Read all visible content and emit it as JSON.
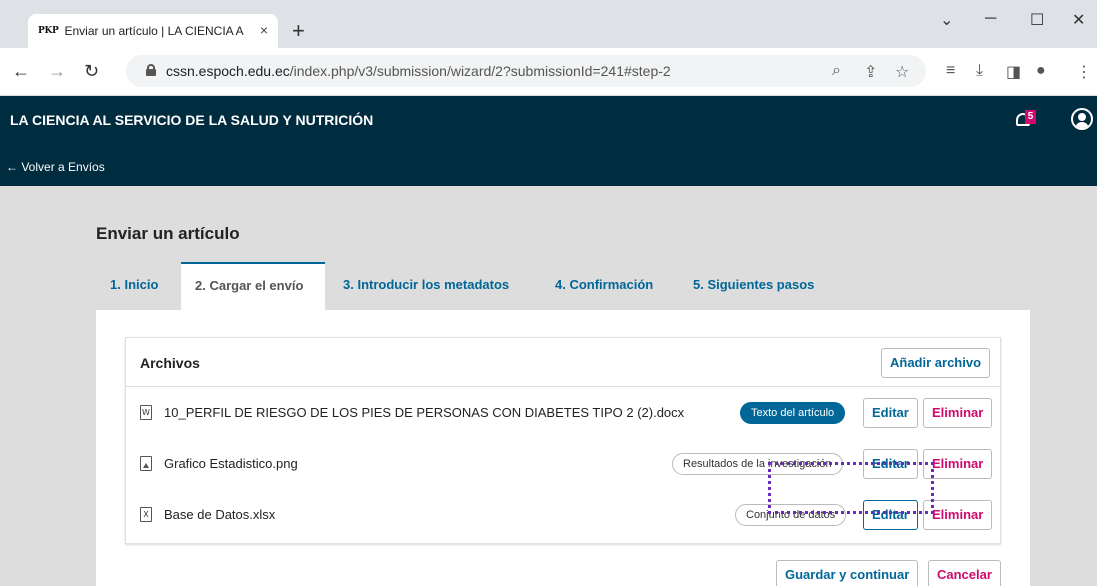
{
  "browser": {
    "tab_title": "Enviar un artículo | LA CIENCIA A",
    "tab_favicon": "PKP",
    "tab_close": "×",
    "new_tab": "+",
    "url_domain": "cssn.espoch.edu.ec",
    "url_path": "/index.php/v3/submission/wizard/2?submissionId=241#step-2",
    "controls": {
      "minimize": "─",
      "maximize": "☐",
      "close": "✕",
      "dropdown": "⌄"
    }
  },
  "app": {
    "site_name": "LA CIENCIA AL SERVICIO DE LA SALUD Y NUTRICIÓN",
    "notification_count": "5",
    "back_link": "← Volver a Envíos"
  },
  "page": {
    "title": "Enviar un artículo",
    "steps": [
      {
        "label": "1. Inicio"
      },
      {
        "label": "2. Cargar el envío"
      },
      {
        "label": "3. Introducir los metadatos"
      },
      {
        "label": "4. Confirmación"
      },
      {
        "label": "5. Siguientes pasos"
      }
    ],
    "active_step": 1
  },
  "files": {
    "title": "Archivos",
    "add_button": "Añadir archivo",
    "edit_label": "Editar",
    "delete_label": "Eliminar",
    "items": [
      {
        "icon": "W",
        "name": "10_PERFIL DE RIESGO DE LOS PIES DE PERSONAS CON DIABETES TIPO 2 (2).docx",
        "genre": "Texto del artículo"
      },
      {
        "icon": "",
        "name": "Grafico Estadistico.png",
        "genre": "Resultados de la investigación"
      },
      {
        "icon": "X",
        "name": "Base de Datos.xlsx",
        "genre": "Conjunto de datos"
      }
    ]
  },
  "actions": {
    "save": "Guardar y continuar",
    "cancel": "Cancelar"
  },
  "colors": {
    "header_bg": "#002c40",
    "primary": "#006798",
    "danger": "#d00a6c",
    "highlight": "#6a2bbd"
  }
}
